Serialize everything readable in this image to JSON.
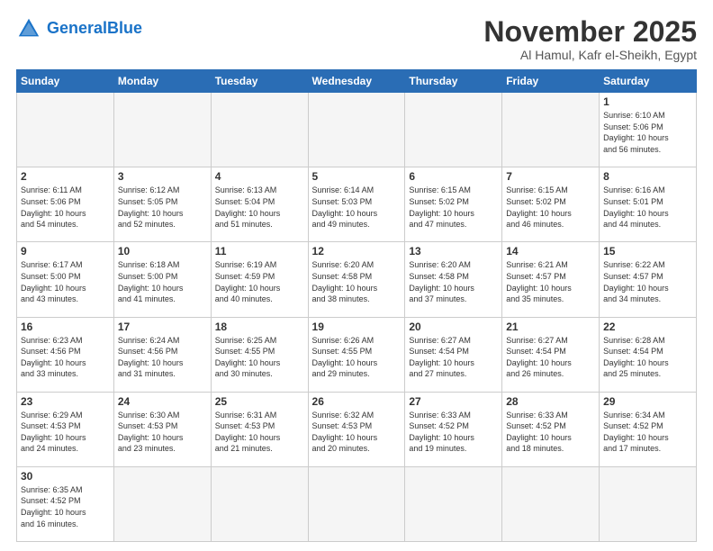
{
  "logo": {
    "text_general": "General",
    "text_blue": "Blue"
  },
  "title": {
    "month_year": "November 2025",
    "location": "Al Hamul, Kafr el-Sheikh, Egypt"
  },
  "weekdays": [
    "Sunday",
    "Monday",
    "Tuesday",
    "Wednesday",
    "Thursday",
    "Friday",
    "Saturday"
  ],
  "weeks": [
    [
      {
        "day": "",
        "info": ""
      },
      {
        "day": "",
        "info": ""
      },
      {
        "day": "",
        "info": ""
      },
      {
        "day": "",
        "info": ""
      },
      {
        "day": "",
        "info": ""
      },
      {
        "day": "",
        "info": ""
      },
      {
        "day": "1",
        "info": "Sunrise: 6:10 AM\nSunset: 5:06 PM\nDaylight: 10 hours\nand 56 minutes."
      }
    ],
    [
      {
        "day": "2",
        "info": "Sunrise: 6:11 AM\nSunset: 5:06 PM\nDaylight: 10 hours\nand 54 minutes."
      },
      {
        "day": "3",
        "info": "Sunrise: 6:12 AM\nSunset: 5:05 PM\nDaylight: 10 hours\nand 52 minutes."
      },
      {
        "day": "4",
        "info": "Sunrise: 6:13 AM\nSunset: 5:04 PM\nDaylight: 10 hours\nand 51 minutes."
      },
      {
        "day": "5",
        "info": "Sunrise: 6:14 AM\nSunset: 5:03 PM\nDaylight: 10 hours\nand 49 minutes."
      },
      {
        "day": "6",
        "info": "Sunrise: 6:15 AM\nSunset: 5:02 PM\nDaylight: 10 hours\nand 47 minutes."
      },
      {
        "day": "7",
        "info": "Sunrise: 6:15 AM\nSunset: 5:02 PM\nDaylight: 10 hours\nand 46 minutes."
      },
      {
        "day": "8",
        "info": "Sunrise: 6:16 AM\nSunset: 5:01 PM\nDaylight: 10 hours\nand 44 minutes."
      }
    ],
    [
      {
        "day": "9",
        "info": "Sunrise: 6:17 AM\nSunset: 5:00 PM\nDaylight: 10 hours\nand 43 minutes."
      },
      {
        "day": "10",
        "info": "Sunrise: 6:18 AM\nSunset: 5:00 PM\nDaylight: 10 hours\nand 41 minutes."
      },
      {
        "day": "11",
        "info": "Sunrise: 6:19 AM\nSunset: 4:59 PM\nDaylight: 10 hours\nand 40 minutes."
      },
      {
        "day": "12",
        "info": "Sunrise: 6:20 AM\nSunset: 4:58 PM\nDaylight: 10 hours\nand 38 minutes."
      },
      {
        "day": "13",
        "info": "Sunrise: 6:20 AM\nSunset: 4:58 PM\nDaylight: 10 hours\nand 37 minutes."
      },
      {
        "day": "14",
        "info": "Sunrise: 6:21 AM\nSunset: 4:57 PM\nDaylight: 10 hours\nand 35 minutes."
      },
      {
        "day": "15",
        "info": "Sunrise: 6:22 AM\nSunset: 4:57 PM\nDaylight: 10 hours\nand 34 minutes."
      }
    ],
    [
      {
        "day": "16",
        "info": "Sunrise: 6:23 AM\nSunset: 4:56 PM\nDaylight: 10 hours\nand 33 minutes."
      },
      {
        "day": "17",
        "info": "Sunrise: 6:24 AM\nSunset: 4:56 PM\nDaylight: 10 hours\nand 31 minutes."
      },
      {
        "day": "18",
        "info": "Sunrise: 6:25 AM\nSunset: 4:55 PM\nDaylight: 10 hours\nand 30 minutes."
      },
      {
        "day": "19",
        "info": "Sunrise: 6:26 AM\nSunset: 4:55 PM\nDaylight: 10 hours\nand 29 minutes."
      },
      {
        "day": "20",
        "info": "Sunrise: 6:27 AM\nSunset: 4:54 PM\nDaylight: 10 hours\nand 27 minutes."
      },
      {
        "day": "21",
        "info": "Sunrise: 6:27 AM\nSunset: 4:54 PM\nDaylight: 10 hours\nand 26 minutes."
      },
      {
        "day": "22",
        "info": "Sunrise: 6:28 AM\nSunset: 4:54 PM\nDaylight: 10 hours\nand 25 minutes."
      }
    ],
    [
      {
        "day": "23",
        "info": "Sunrise: 6:29 AM\nSunset: 4:53 PM\nDaylight: 10 hours\nand 24 minutes."
      },
      {
        "day": "24",
        "info": "Sunrise: 6:30 AM\nSunset: 4:53 PM\nDaylight: 10 hours\nand 23 minutes."
      },
      {
        "day": "25",
        "info": "Sunrise: 6:31 AM\nSunset: 4:53 PM\nDaylight: 10 hours\nand 21 minutes."
      },
      {
        "day": "26",
        "info": "Sunrise: 6:32 AM\nSunset: 4:53 PM\nDaylight: 10 hours\nand 20 minutes."
      },
      {
        "day": "27",
        "info": "Sunrise: 6:33 AM\nSunset: 4:52 PM\nDaylight: 10 hours\nand 19 minutes."
      },
      {
        "day": "28",
        "info": "Sunrise: 6:33 AM\nSunset: 4:52 PM\nDaylight: 10 hours\nand 18 minutes."
      },
      {
        "day": "29",
        "info": "Sunrise: 6:34 AM\nSunset: 4:52 PM\nDaylight: 10 hours\nand 17 minutes."
      }
    ],
    [
      {
        "day": "30",
        "info": "Sunrise: 6:35 AM\nSunset: 4:52 PM\nDaylight: 10 hours\nand 16 minutes."
      },
      {
        "day": "",
        "info": ""
      },
      {
        "day": "",
        "info": ""
      },
      {
        "day": "",
        "info": ""
      },
      {
        "day": "",
        "info": ""
      },
      {
        "day": "",
        "info": ""
      },
      {
        "day": "",
        "info": ""
      }
    ]
  ]
}
